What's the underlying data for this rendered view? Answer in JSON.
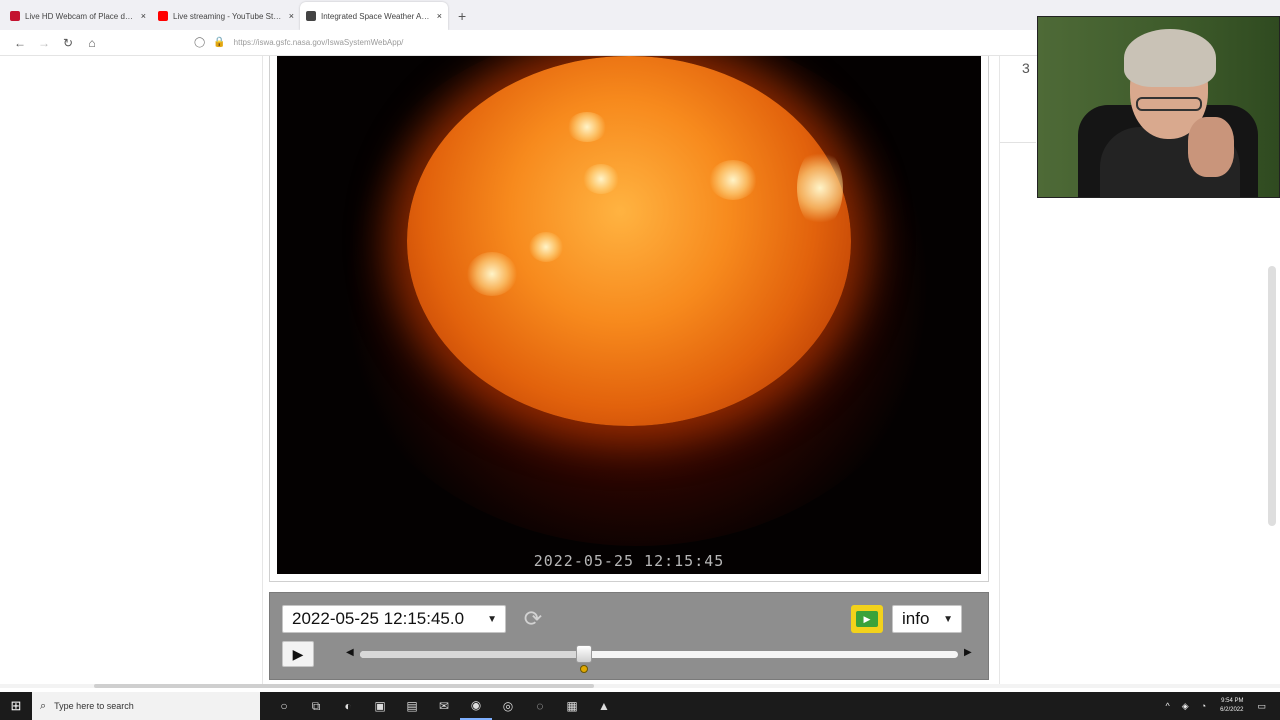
{
  "browser": {
    "tabs": [
      {
        "label": "Live HD Webcam of Place de la...",
        "favicon_color": "#c4122f",
        "active": false
      },
      {
        "label": "Live streaming - YouTube Studio",
        "favicon_color": "#ff0000",
        "active": false
      },
      {
        "label": "Integrated Space Weather Ana...",
        "favicon_color": "#444444",
        "active": true
      }
    ],
    "close_glyph": "×",
    "new_tab_glyph": "+",
    "nav": {
      "back": "←",
      "forward": "→",
      "reload": "↻",
      "home": "⌂"
    },
    "url": "https://iswa.gsfc.nasa.gov/IswaSystemWebApp/",
    "url_icons": {
      "shield": "◯",
      "lock": "🔒"
    }
  },
  "viewer": {
    "image_timestamp": "2022-05-25 12:15:45",
    "selected_datetime": "2022-05-25 12:15:45.0",
    "dropdown_caret": "▼",
    "refresh_glyph": "⟳",
    "movie_glyph": "▶",
    "info_label": "info",
    "play_glyph": "▶",
    "slider_left_glyph": "◀",
    "slider_right_glyph": "▶",
    "slider_position": 0.375,
    "colors": {
      "panel": "#8e8e8e",
      "sun": "#f78a1d",
      "movie_frame": "#f2d21b",
      "movie_inner": "#3aa23a"
    }
  },
  "page_right": {
    "number_fragment": "3"
  },
  "taskbar": {
    "start_glyph": "⊞",
    "search_icon": "⌕",
    "search_placeholder": "Type here to search",
    "apps": [
      {
        "name": "cortana-icon",
        "glyph": "○"
      },
      {
        "name": "task-view-icon",
        "glyph": "⧉"
      },
      {
        "name": "edge-icon",
        "glyph": "◐"
      },
      {
        "name": "store-icon",
        "glyph": "▣"
      },
      {
        "name": "file-explorer-icon",
        "glyph": "▤"
      },
      {
        "name": "mail-icon",
        "glyph": "✉"
      },
      {
        "name": "firefox-icon",
        "glyph": "◉"
      },
      {
        "name": "browser-icon",
        "glyph": "◎"
      },
      {
        "name": "chrome-icon",
        "glyph": "◌"
      },
      {
        "name": "settings-app-icon",
        "glyph": "▦"
      },
      {
        "name": "vlc-icon",
        "glyph": "▲"
      }
    ],
    "tray": {
      "up": "^",
      "network": "◈",
      "volume": "◔"
    },
    "clock_time": "9:54 PM",
    "clock_date": "6/2/2022",
    "notification_glyph": "▭"
  }
}
